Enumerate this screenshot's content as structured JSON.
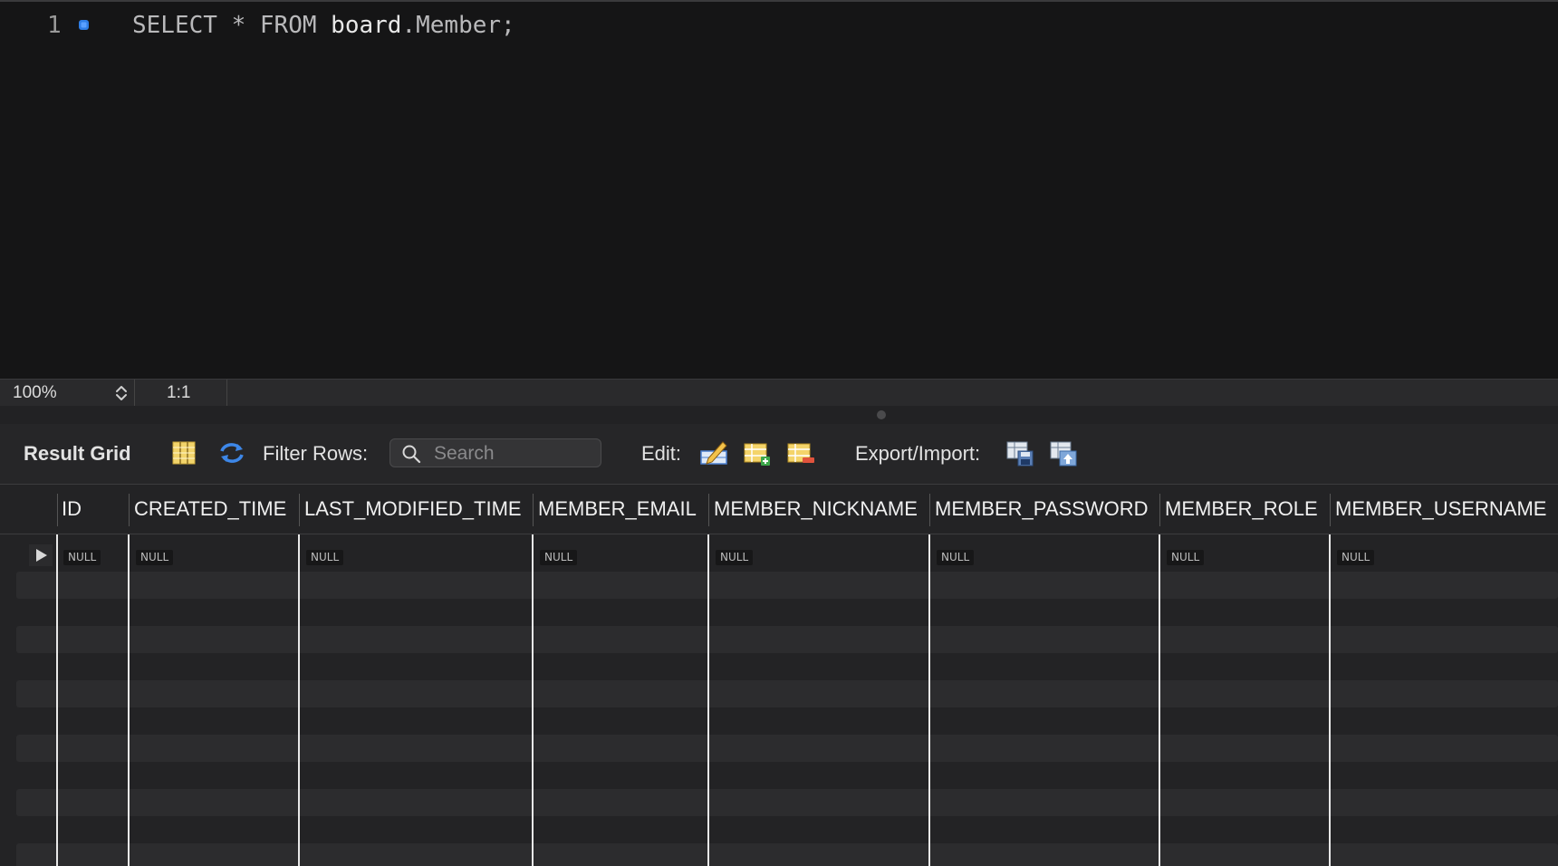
{
  "editor": {
    "line_number": "1",
    "sql": {
      "select_kw": "SELECT",
      "star": "*",
      "from_kw": "FROM",
      "schema": "board",
      "dot": ".",
      "table": "Member",
      "semicolon": ";"
    }
  },
  "status_bar": {
    "zoom": "100%",
    "cursor_position": "1:1"
  },
  "toolbar": {
    "result_grid_label": "Result Grid",
    "filter_rows_label": "Filter Rows:",
    "search_placeholder": "Search",
    "edit_label": "Edit:",
    "export_import_label": "Export/Import:"
  },
  "grid": {
    "columns": [
      "ID",
      "CREATED_TIME",
      "LAST_MODIFIED_TIME",
      "MEMBER_EMAIL",
      "MEMBER_NICKNAME",
      "MEMBER_PASSWORD",
      "MEMBER_ROLE",
      "MEMBER_USERNAME"
    ],
    "rows": [
      [
        "NULL",
        "NULL",
        "NULL",
        "NULL",
        "NULL",
        "NULL",
        "NULL",
        "NULL"
      ]
    ]
  },
  "colors": {
    "background": "#141415",
    "panel": "#262628",
    "accent_blue": "#2f7ee6",
    "null_badge": "#171718"
  }
}
